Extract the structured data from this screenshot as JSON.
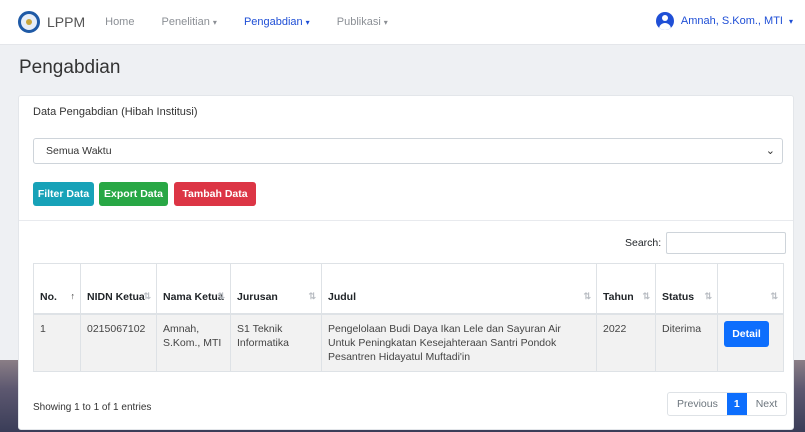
{
  "navbar": {
    "brand": "LPPM",
    "items": [
      {
        "label": "Home",
        "caret": ""
      },
      {
        "label": "Penelitian",
        "caret": "▾"
      },
      {
        "label": "Pengabdian",
        "caret": "▾"
      },
      {
        "label": "Publikasi",
        "caret": "▾"
      }
    ],
    "user": "Amnah, S.Kom., MTI",
    "user_caret": "▾"
  },
  "page": {
    "title": "Pengabdian"
  },
  "card": {
    "title": "Data Pengabdian (Hibah Institusi)",
    "filter_select": "Semua Waktu",
    "buttons": {
      "filter": "Filter Data",
      "export": "Export Data",
      "add": "Tambah Data"
    },
    "search_label": "Search:"
  },
  "table": {
    "headers": [
      "No.",
      "NIDN Ketua",
      "Nama Ketua",
      "Jurusan",
      "Judul",
      "Tahun",
      "Status",
      ""
    ],
    "rows": [
      {
        "no": "1",
        "nidn": "0215067102",
        "nama": "Amnah, S.Kom., MTI",
        "jurusan": "S1 Teknik Informatika",
        "judul": "Pengelolaan Budi Daya Ikan Lele dan Sayuran Air Untuk Peningkatan Kesejahteraan Santri Pondok Pesantren Hidayatul Muftadi'in",
        "tahun": "2022",
        "status": "Diterima",
        "action": "Detail"
      }
    ]
  },
  "footer": {
    "info": "Showing 1 to 1 of 1 entries",
    "previous": "Previous",
    "page": "1",
    "next": "Next"
  },
  "colors": {
    "primary": "#0d6efd",
    "info": "#17a2b8",
    "success": "#28a745",
    "danger": "#dc3545"
  }
}
